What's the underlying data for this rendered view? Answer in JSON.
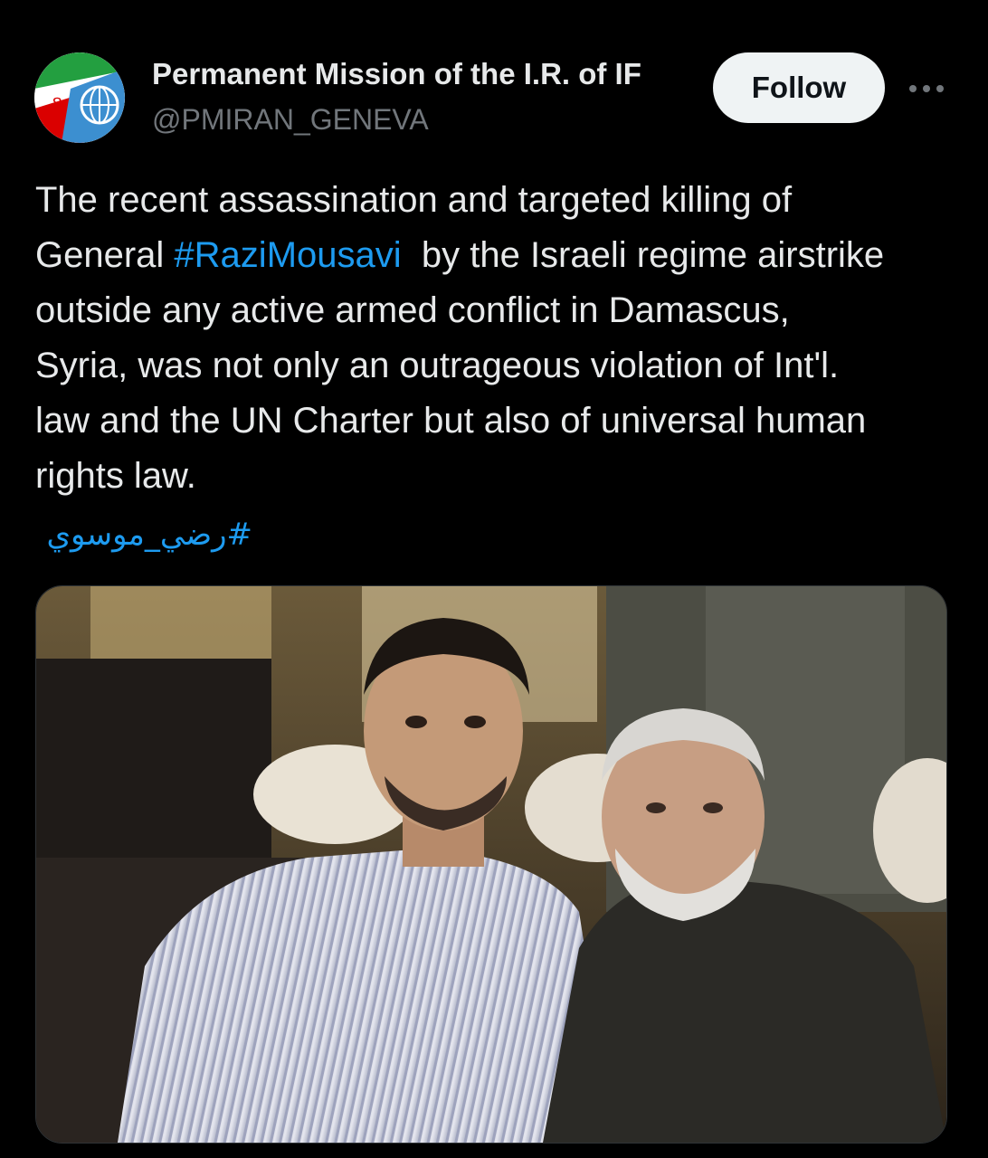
{
  "post": {
    "author": {
      "display_name": "Permanent Mission of the I.R. of IF",
      "handle": "@PMIRAN_GENEVA",
      "avatar_icon": "avatar-iran-flag-un-emblem"
    },
    "follow_label": "Follow",
    "more_icon": "more-horizontal-icon",
    "text_lines": [
      "The recent assassination and targeted killing of",
      "General ",
      "#RaziMousavi",
      "  by the Israeli regime airstrike",
      "outside any active armed conflict in Damascus,",
      "Syria, was not only an outrageous violation of Int'l.",
      "law and the UN Charter but also of universal human",
      "rights law."
    ],
    "arabic_hashtag": "#رضي_موسوي",
    "media_icon": "photo-two-men-seated"
  },
  "colors": {
    "background": "#000000",
    "text": "#e7e9ea",
    "secondary": "#71767b",
    "link": "#1d9bf0",
    "follow_bg": "#eff3f4"
  }
}
